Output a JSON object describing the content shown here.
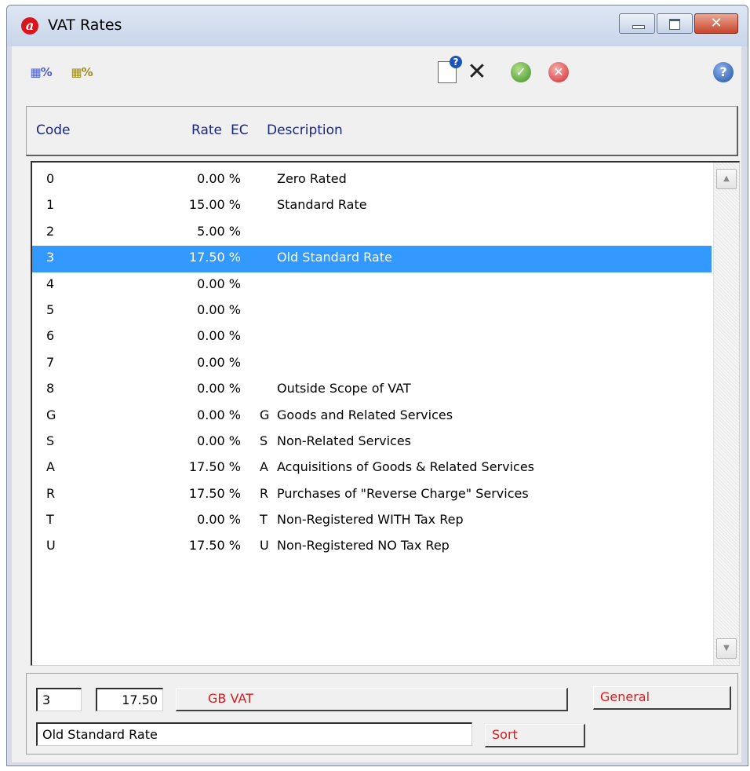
{
  "window": {
    "title": "VAT Rates",
    "logo_letter": "a",
    "minimize_icon": "minimize-icon",
    "maximize_icon": "maximize-icon",
    "close_icon": "close-icon",
    "close_glyph": "✕"
  },
  "toolbar": {
    "vat_percent_icon": "%",
    "vat_percent_alt_icon": "%",
    "ok_glyph": "✓",
    "cancel_glyph": "✕",
    "help_glyph": "?",
    "delete_glyph": "✕",
    "doc_help_glyph": "?"
  },
  "columns": {
    "code": "Code",
    "rate": "Rate",
    "ec": "EC",
    "description": "Description"
  },
  "rows": [
    {
      "code": "0",
      "rate": "0.00 %",
      "ec": "",
      "description": "Zero Rated"
    },
    {
      "code": "1",
      "rate": "15.00 %",
      "ec": "",
      "description": "Standard Rate"
    },
    {
      "code": "2",
      "rate": "5.00 %",
      "ec": "",
      "description": ""
    },
    {
      "code": "3",
      "rate": "17.50 %",
      "ec": "",
      "description": "Old Standard Rate",
      "selected": true
    },
    {
      "code": "4",
      "rate": "0.00 %",
      "ec": "",
      "description": ""
    },
    {
      "code": "5",
      "rate": "0.00 %",
      "ec": "",
      "description": ""
    },
    {
      "code": "6",
      "rate": "0.00 %",
      "ec": "",
      "description": ""
    },
    {
      "code": "7",
      "rate": "0.00 %",
      "ec": "",
      "description": ""
    },
    {
      "code": "8",
      "rate": "0.00 %",
      "ec": "",
      "description": "Outside Scope of VAT"
    },
    {
      "code": "G",
      "rate": "0.00 %",
      "ec": "G",
      "description": "Goods and Related Services"
    },
    {
      "code": "S",
      "rate": "0.00 %",
      "ec": "S",
      "description": "Non-Related Services"
    },
    {
      "code": "A",
      "rate": "17.50 %",
      "ec": "A",
      "description": "Acquisitions of Goods & Related Services"
    },
    {
      "code": "R",
      "rate": "17.50 %",
      "ec": "R",
      "description": "Purchases of \"Reverse Charge\" Services"
    },
    {
      "code": "T",
      "rate": "0.00 %",
      "ec": "T",
      "description": "Non-Registered WITH Tax Rep"
    },
    {
      "code": "U",
      "rate": "17.50 %",
      "ec": "U",
      "description": "Non-Registered NO Tax Rep"
    }
  ],
  "detail": {
    "code_value": "3",
    "rate_value": "17.50",
    "vat_type_button": "GB VAT",
    "category_button": "General",
    "description_value": "Old Standard Rate",
    "sort_button": "Sort"
  },
  "colors": {
    "selection": "#3399ff",
    "header_text": "#1a2580",
    "button_text": "#e0181c"
  }
}
